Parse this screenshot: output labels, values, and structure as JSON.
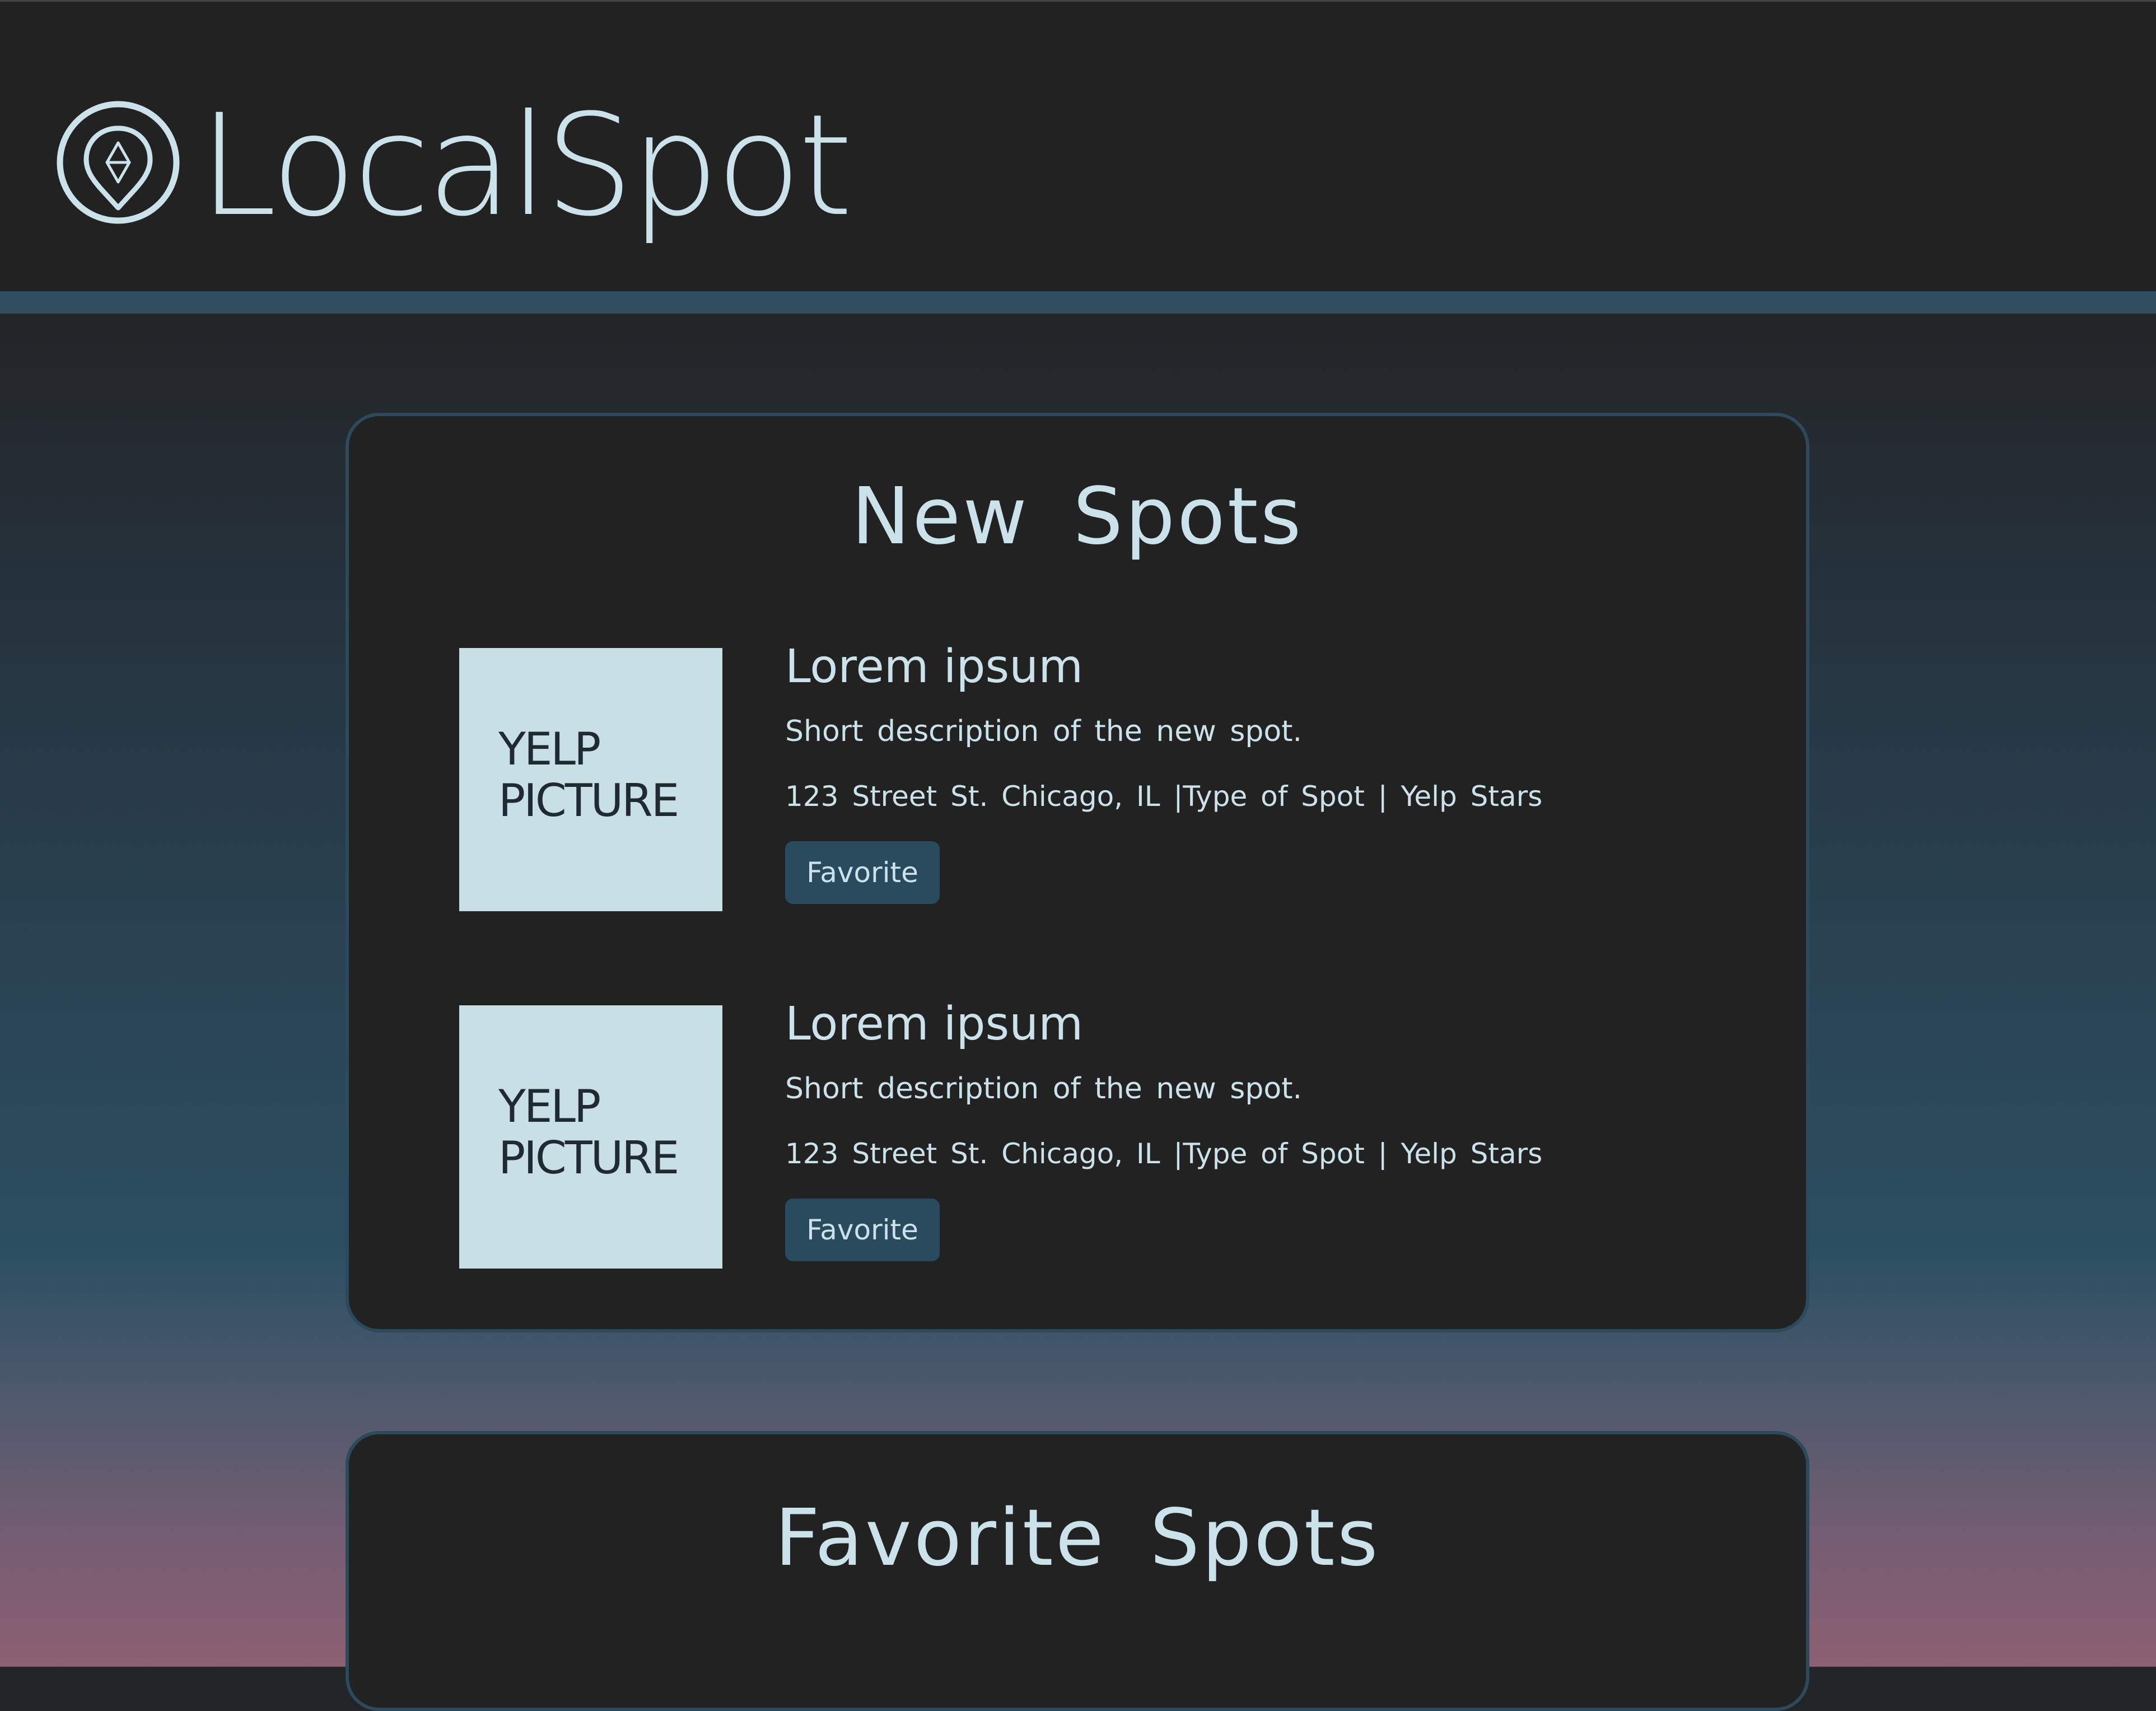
{
  "brand": {
    "name": "LocalSpot",
    "logo_icon": "map-pin-star-icon",
    "text_color": "#cbe2ea"
  },
  "colors": {
    "header_bg": "#222222",
    "header_stripe": "#2f4f61",
    "panel_bg": "#222222",
    "accent": "#2a4b5d",
    "image_placeholder": "#c8dfe6",
    "text": "#cbe2ea"
  },
  "new_spots": {
    "title": "New Spots",
    "items": [
      {
        "image_label": "YELP\nPICTURE",
        "title": "Lorem ipsum",
        "description": "Short description of the new spot.",
        "meta": "123 Street St. Chicago, IL |Type of Spot | Yelp Stars",
        "button": "Favorite"
      },
      {
        "image_label": "YELP\nPICTURE",
        "title": "Lorem ipsum",
        "description": "Short description of the new spot.",
        "meta": "123 Street St. Chicago, IL |Type of Spot | Yelp Stars",
        "button": "Favorite"
      }
    ]
  },
  "favorite_spots": {
    "title": "Favorite Spots"
  }
}
